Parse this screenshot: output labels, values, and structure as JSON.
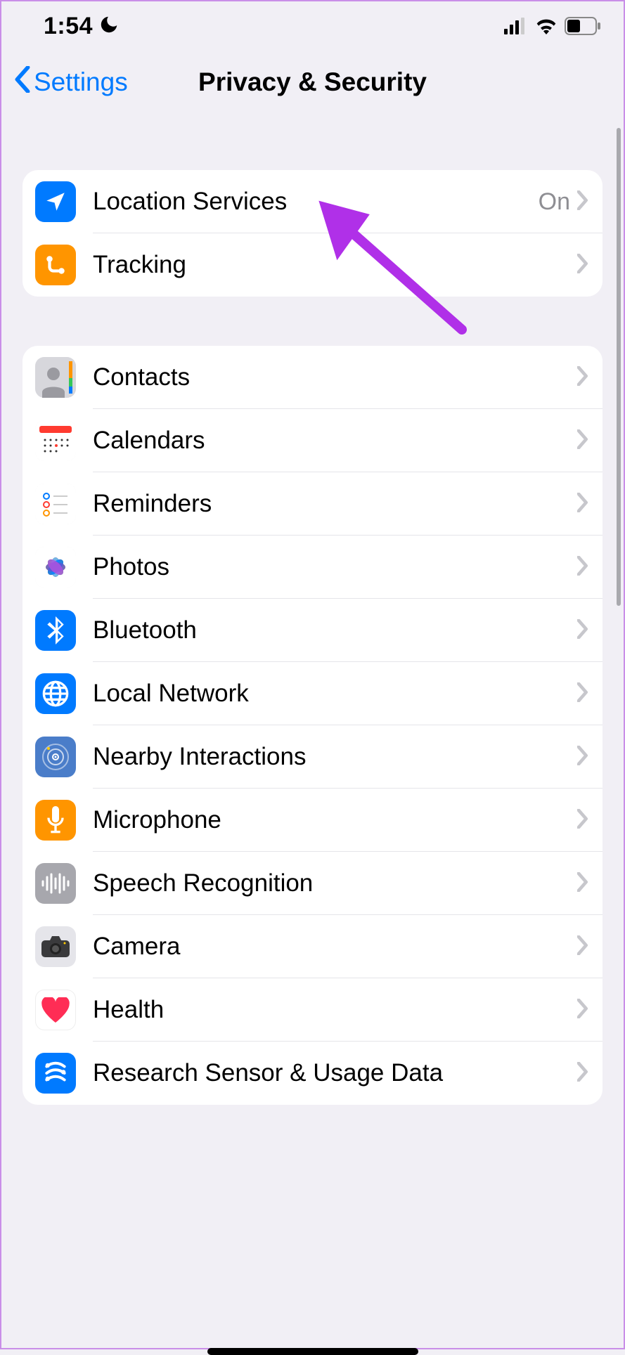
{
  "status": {
    "time": "1:54"
  },
  "nav": {
    "back": "Settings",
    "title": "Privacy & Security"
  },
  "group1": [
    {
      "key": "location",
      "label": "Location Services",
      "value": "On"
    },
    {
      "key": "tracking",
      "label": "Tracking",
      "value": ""
    }
  ],
  "group2": [
    {
      "key": "contacts",
      "label": "Contacts"
    },
    {
      "key": "calendars",
      "label": "Calendars"
    },
    {
      "key": "reminders",
      "label": "Reminders"
    },
    {
      "key": "photos",
      "label": "Photos"
    },
    {
      "key": "bluetooth",
      "label": "Bluetooth"
    },
    {
      "key": "localnet",
      "label": "Local Network"
    },
    {
      "key": "nearby",
      "label": "Nearby Interactions"
    },
    {
      "key": "microphone",
      "label": "Microphone"
    },
    {
      "key": "speech",
      "label": "Speech Recognition"
    },
    {
      "key": "camera",
      "label": "Camera"
    },
    {
      "key": "health",
      "label": "Health"
    },
    {
      "key": "research",
      "label": "Research Sensor & Usage Data"
    }
  ]
}
